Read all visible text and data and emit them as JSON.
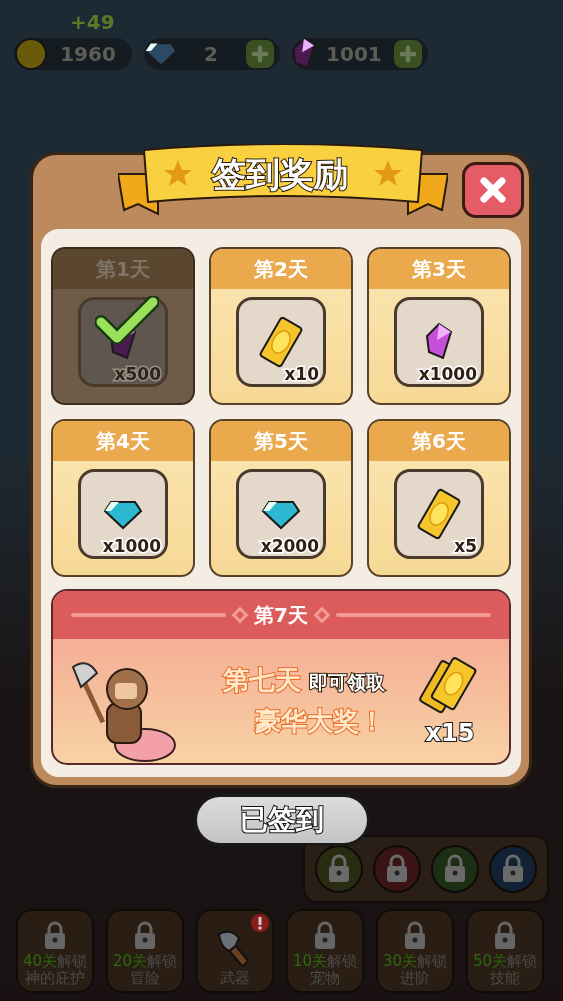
{
  "gain": "+49",
  "currencies": [
    {
      "kind": "coin",
      "value": "1960",
      "plus": false
    },
    {
      "kind": "gem",
      "value": "2",
      "plus": true
    },
    {
      "kind": "crystal",
      "value": "1001",
      "plus": true
    }
  ],
  "dialog": {
    "title": "签到奖励",
    "days": [
      {
        "label": "第1天",
        "kind": "crystal",
        "amount": "x500",
        "claimed": true
      },
      {
        "label": "第2天",
        "kind": "ticket",
        "amount": "x10",
        "claimed": false
      },
      {
        "label": "第3天",
        "kind": "crystal",
        "amount": "x1000",
        "claimed": false
      },
      {
        "label": "第4天",
        "kind": "gem",
        "amount": "x1000",
        "claimed": false
      },
      {
        "label": "第5天",
        "kind": "gem",
        "amount": "x2000",
        "claimed": false
      },
      {
        "label": "第6天",
        "kind": "ticket",
        "amount": "x5",
        "claimed": false
      }
    ],
    "grand": {
      "label": "第7天",
      "highlight": "第七天",
      "note": "即可领取",
      "headline": "豪华大奖！",
      "kind": "tickets",
      "amount": "x15"
    },
    "button": {
      "label": "已签到",
      "disabled": true
    }
  },
  "lock_slots": [
    {
      "color": "#2a2c12"
    },
    {
      "color": "#3a1414"
    },
    {
      "color": "#1c2e14"
    },
    {
      "color": "#122234"
    }
  ],
  "nav": [
    {
      "stage": "40关",
      "action": "解锁",
      "name": "神的庇护",
      "locked": true,
      "alert": false
    },
    {
      "stage": "20关",
      "action": "解锁",
      "name": "冒险",
      "locked": true,
      "alert": false
    },
    {
      "name": "武器",
      "locked": false,
      "alert": true
    },
    {
      "stage": "10关",
      "action": "解锁",
      "name": "宠物",
      "locked": true,
      "alert": false
    },
    {
      "stage": "30关",
      "action": "解锁",
      "name": "进阶",
      "locked": true,
      "alert": false
    },
    {
      "stage": "50关",
      "action": "解锁",
      "name": "技能",
      "locked": true,
      "alert": false
    }
  ]
}
